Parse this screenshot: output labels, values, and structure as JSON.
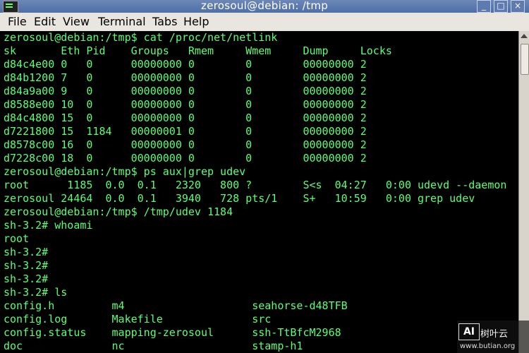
{
  "window": {
    "title": "zerosoul@debian: /tmp",
    "minimize": "_",
    "maximize": "□",
    "close": "×"
  },
  "menu": [
    {
      "label": "File"
    },
    {
      "label": "Edit"
    },
    {
      "label": "View"
    },
    {
      "label": "Terminal"
    },
    {
      "label": "Tabs"
    },
    {
      "label": "Help"
    }
  ],
  "terminal": {
    "lines": [
      "zerosoul@debian:/tmp$ cat /proc/net/netlink",
      "sk       Eth Pid    Groups   Rmem     Wmem     Dump     Locks",
      "d84c4e00 0   0      00000000 0        0        00000000 2",
      "d84b1200 7   0      00000000 0        0        00000000 2",
      "d84a9a00 9   0      00000000 0        0        00000000 2",
      "d8588e00 10  0      00000000 0        0        00000000 2",
      "d84c4800 15  0      00000000 0        0        00000000 2",
      "d7221800 15  1184   00000001 0        0        00000000 2",
      "d8578c00 16  0      00000000 0        0        00000000 2",
      "d7228c00 18  0      00000000 0        0        00000000 2",
      "zerosoul@debian:/tmp$ ps aux|grep udev",
      "root      1185  0.0  0.1   2320   800 ?        S<s  04:27   0:00 udevd --daemon",
      "zerosoul 24464  0.0  0.1   3940   728 pts/1    S+   10:59   0:00 grep udev",
      "zerosoul@debian:/tmp$ /tmp/udev 1184",
      "sh-3.2# whoami",
      "root",
      "sh-3.2#",
      "sh-3.2#",
      "sh-3.2#",
      "sh-3.2# ls",
      "config.h         m4                    seahorse-d48TFB",
      "config.log       Makefile              src",
      "config.status    mapping-zerosoul      ssh-TtBfcM2968",
      "doc              nc                    stamp-h1"
    ]
  },
  "watermark": {
    "logo": "AI",
    "site": "树叶云",
    "url": "www.butian.org"
  },
  "colors": {
    "terminal_text": "#5cff73",
    "terminal_bg": "#000000",
    "titlebar": "#5b78ae"
  }
}
